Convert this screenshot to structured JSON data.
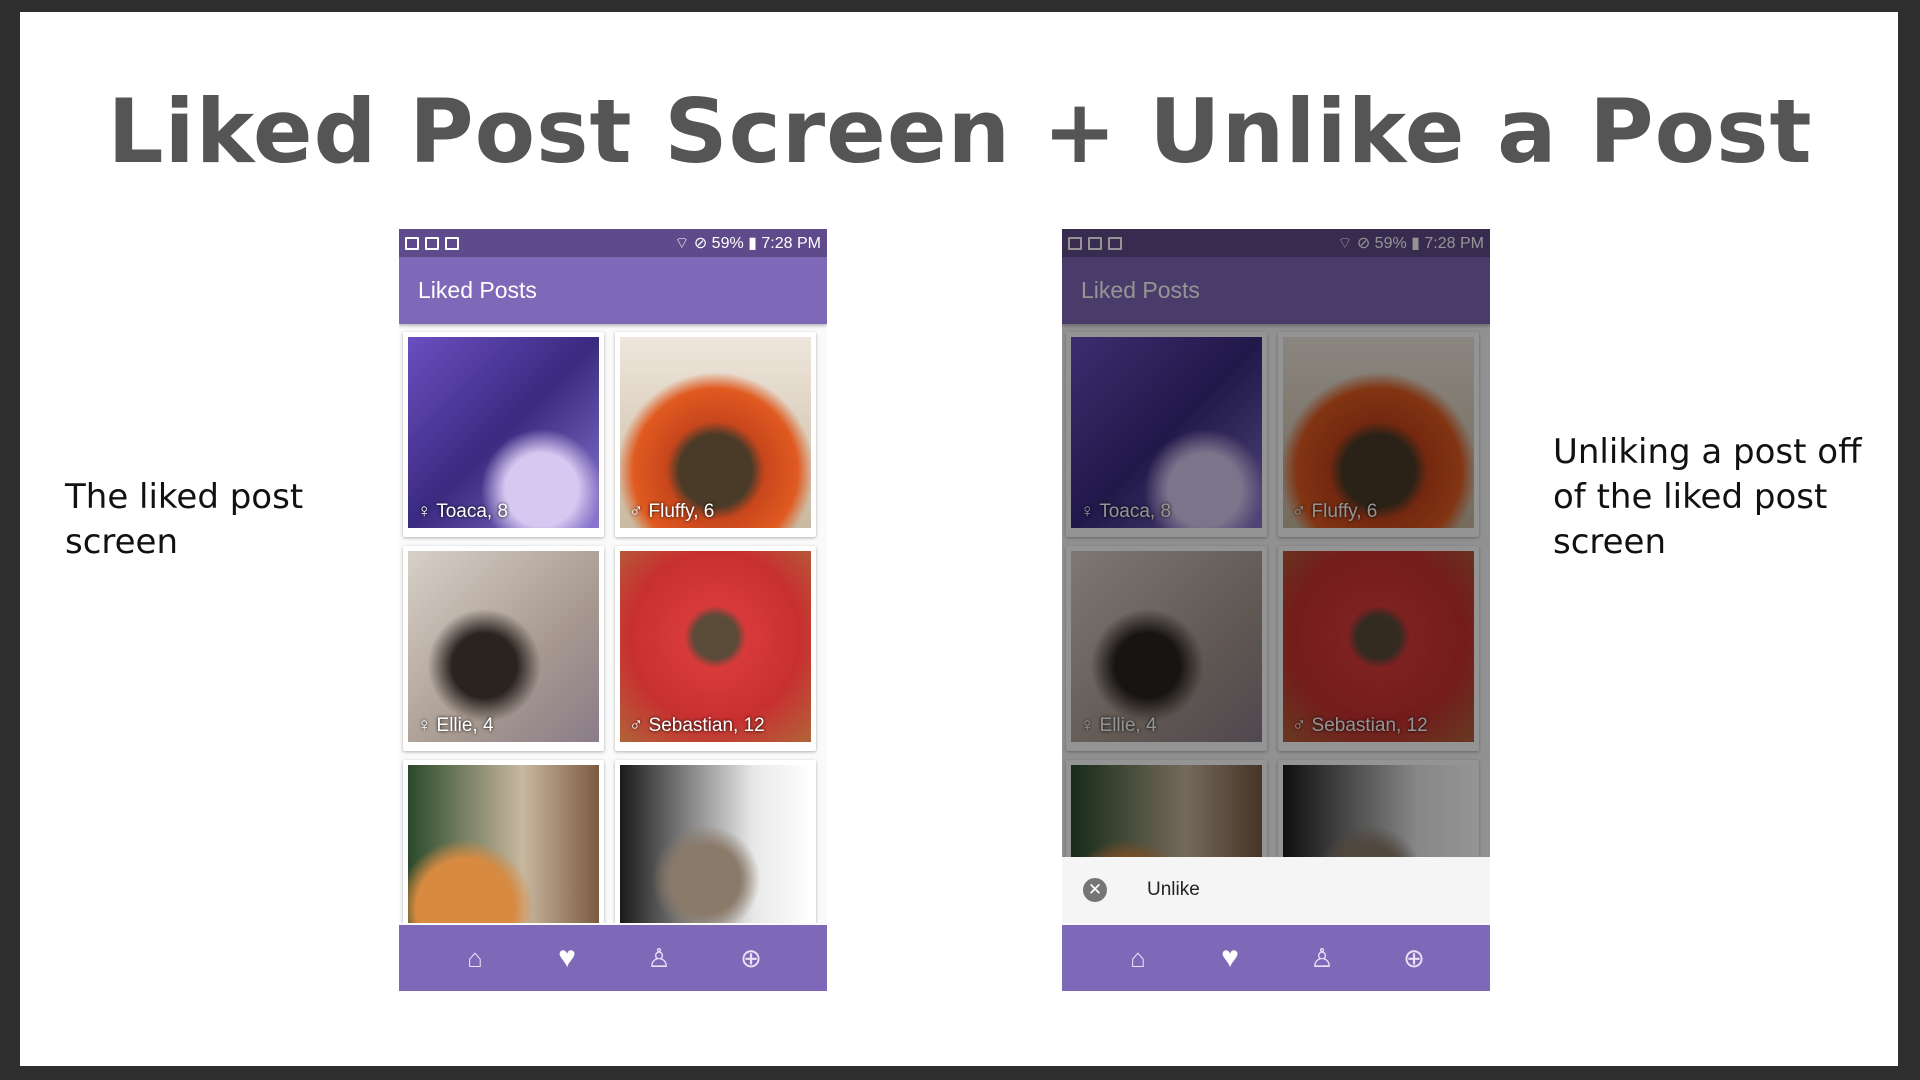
{
  "title": "Liked Post Screen + Unlike a Post",
  "captions": {
    "left": "The liked post screen",
    "right": "Unliking a post off of the liked post screen"
  },
  "phone": {
    "status": {
      "battery": "59%",
      "time": "7:28 PM"
    },
    "app_title": "Liked Posts",
    "posts": [
      {
        "gender": "♀",
        "label": "Toaca, 8"
      },
      {
        "gender": "♂",
        "label": "Fluffy, 6"
      },
      {
        "gender": "♀",
        "label": "Ellie, 4"
      },
      {
        "gender": "♂",
        "label": "Sebastian, 12"
      },
      {
        "gender": "",
        "label": ""
      },
      {
        "gender": "",
        "label": ""
      }
    ],
    "nav": [
      "home-icon",
      "heart-icon",
      "person-icon",
      "add-circle-icon"
    ]
  },
  "snackbar": {
    "action": "Unlike"
  }
}
